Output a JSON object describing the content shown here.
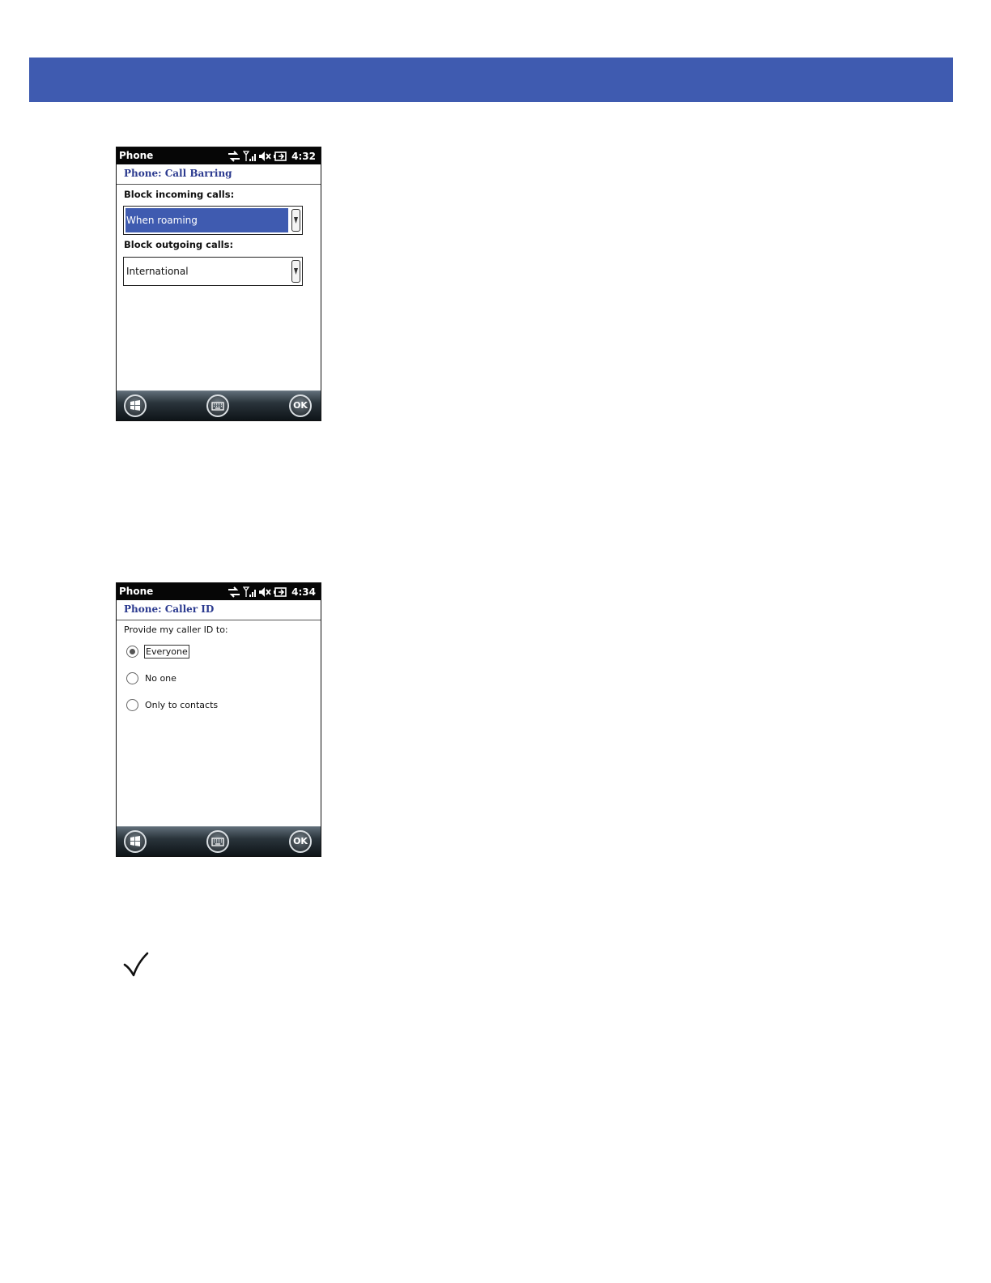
{
  "screen1": {
    "app_name": "Phone",
    "clock": "4:32",
    "title": "Phone: Call Barring",
    "incoming_label": "Block incoming calls:",
    "incoming_value": "When roaming",
    "outgoing_label": "Block outgoing calls:",
    "outgoing_value": "International",
    "ok_label": "OK"
  },
  "screen2": {
    "app_name": "Phone",
    "clock": "4:34",
    "title": "Phone: Caller ID",
    "prompt": "Provide my caller ID to:",
    "options": [
      "Everyone",
      "No one",
      "Only to contacts"
    ],
    "selected_option": "Everyone",
    "ok_label": "OK"
  },
  "colors": {
    "band": "#3f5bb0",
    "title_text": "#2b3a8f",
    "selection": "#3f5bb0"
  },
  "icons": [
    "data-sync-icon",
    "signal-icon",
    "speaker-muted-icon",
    "battery-icon",
    "windows-start-icon",
    "keyboard-icon",
    "check-icon"
  ]
}
